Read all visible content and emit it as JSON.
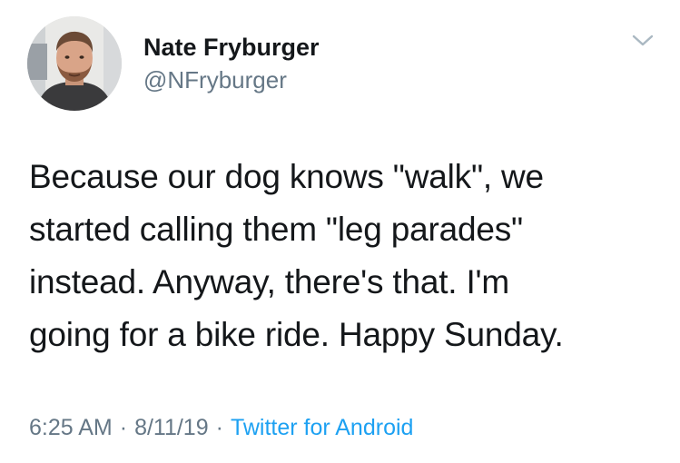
{
  "tweet": {
    "display_name": "Nate Fryburger",
    "handle": "@NFryburger",
    "text": "Because our dog knows \"walk\", we\nstarted calling them \"leg parades\"\ninstead. Anyway, there's that. I'm\ngoing for a bike ride. Happy Sunday.",
    "time": "6:25 AM",
    "separator": "·",
    "date": "8/11/19",
    "source": "Twitter for Android"
  },
  "icons": {
    "menu": "chevron-down-icon"
  },
  "colors": {
    "text": "#14171a",
    "secondary": "#657786",
    "link": "#1da1f2",
    "chevron": "#aab8c2"
  }
}
